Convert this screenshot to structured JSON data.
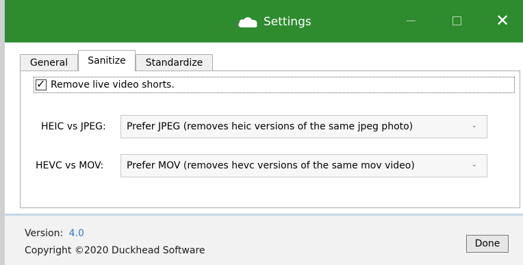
{
  "window": {
    "title": "Settings",
    "icons": {
      "app": "cloud-icon",
      "minimize": "minimize-icon",
      "maximize": "maximize-icon",
      "close": "close-icon"
    },
    "colors": {
      "titlebar": "#2e8b2e",
      "accent": "#2b79c2"
    }
  },
  "tabs": [
    {
      "label": "General"
    },
    {
      "label": "Sanitize",
      "selected": true
    },
    {
      "label": "Standardize"
    }
  ],
  "sanitize": {
    "remove_live_video": {
      "label": "Remove live video shorts.",
      "checked": true
    },
    "heic_vs_jpeg": {
      "label": "HEIC vs JPEG:",
      "value": "Prefer JPEG (removes heic versions of the same jpeg photo)"
    },
    "hevc_vs_mov": {
      "label": "HEVC vs MOV:",
      "value": "Prefer MOV (removes hevc versions of the same mov video)"
    }
  },
  "footer": {
    "version_label": "Version:",
    "version_value": "4.0",
    "copyright": "Copyright ©2020 Duckhead Software",
    "done_label": "Done"
  }
}
